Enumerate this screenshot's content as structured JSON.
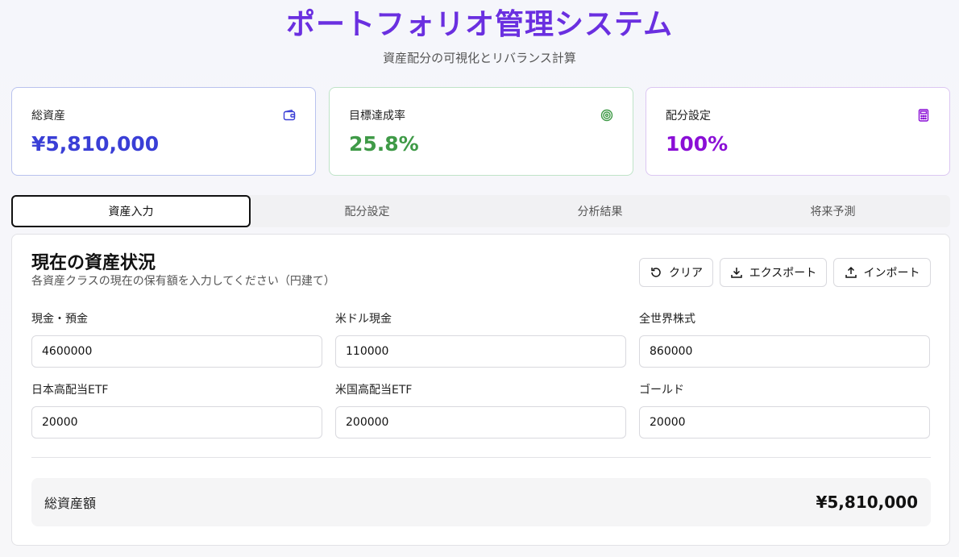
{
  "header": {
    "title": "ポートフォリオ管理システム",
    "subtitle": "資産配分の可視化とリバランス計算"
  },
  "stats": [
    {
      "label": "総資産",
      "value": "¥5,810,000",
      "icon": "wallet-icon",
      "color": "#3a3fd6"
    },
    {
      "label": "目標達成率",
      "value": "25.8%",
      "icon": "target-icon",
      "color": "#3f9a47"
    },
    {
      "label": "配分設定",
      "value": "100%",
      "icon": "calculator-icon",
      "color": "#8a0fd6"
    }
  ],
  "tabs": [
    {
      "label": "資産入力",
      "active": true
    },
    {
      "label": "配分設定",
      "active": false
    },
    {
      "label": "分析結果",
      "active": false
    },
    {
      "label": "将来予測",
      "active": false
    }
  ],
  "panel": {
    "title": "現在の資産状況",
    "description": "各資産クラスの現在の保有額を入力してください（円建て）",
    "buttons": {
      "clear": "クリア",
      "export": "エクスポート",
      "import": "インポート"
    },
    "fields": [
      {
        "label": "現金・預金",
        "value": "4600000"
      },
      {
        "label": "米ドル現金",
        "value": "110000"
      },
      {
        "label": "全世界株式",
        "value": "860000"
      },
      {
        "label": "日本高配当ETF",
        "value": "20000"
      },
      {
        "label": "米国高配当ETF",
        "value": "200000"
      },
      {
        "label": "ゴールド",
        "value": "20000"
      }
    ],
    "total": {
      "label": "総資産額",
      "value": "¥5,810,000"
    }
  }
}
